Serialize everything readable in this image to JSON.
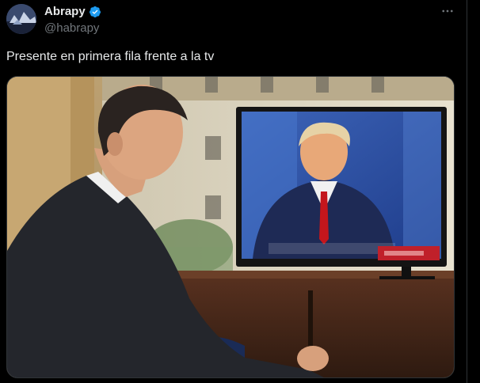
{
  "post": {
    "author_name": "Abrapy",
    "author_handle": "@habrapy",
    "verified": true,
    "text": "Presente en primera fila frente a la tv",
    "more_icon": "more-horizontal-icon"
  },
  "colors": {
    "background": "#000000",
    "text": "#e7e9ea",
    "muted": "#71767b",
    "verified_blue": "#1d9bf0"
  }
}
